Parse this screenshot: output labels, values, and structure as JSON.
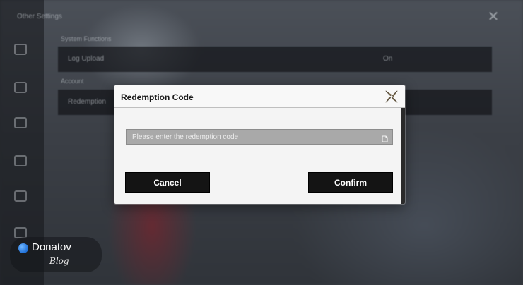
{
  "background": {
    "title": "Other Settings",
    "section_1": "System Functions",
    "row_1_label": "Log Upload",
    "row_1_value": "On",
    "section_2": "Account",
    "row_2_label": "Redemption"
  },
  "dialog": {
    "title": "Redemption Code",
    "close_icon": "close-x-icon",
    "input": {
      "placeholder": "Please enter the redemption code",
      "value": "",
      "icon": "paste-icon"
    },
    "cancel_label": "Cancel",
    "confirm_label": "Confirm"
  },
  "watermark": {
    "name": "Donatov",
    "sub": "Blog"
  },
  "colors": {
    "dialog_bg": "#f4f4f4",
    "button_bg": "#141414",
    "input_bg": "#a9a9a9"
  }
}
